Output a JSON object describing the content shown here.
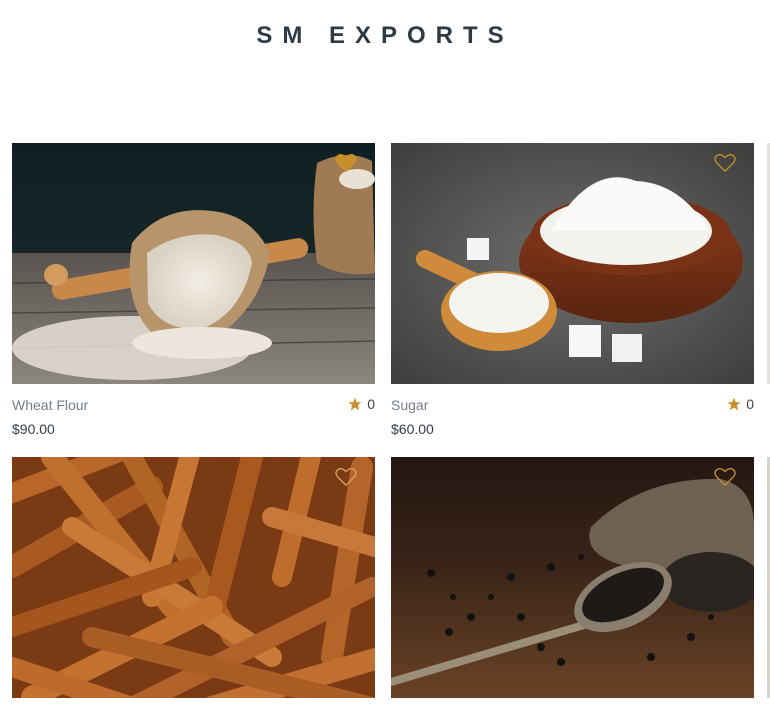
{
  "brand": {
    "title": "SM EXPORTS"
  },
  "colors": {
    "accent": "#c8902a",
    "text": "#333d46",
    "muted": "#757f88"
  },
  "products": [
    {
      "name": "Wheat Flour",
      "price": "$90.00",
      "rating": "0",
      "favorited": true,
      "image": "wheat-flour-sack-photo"
    },
    {
      "name": "Sugar",
      "price": "$60.00",
      "rating": "0",
      "favorited": false,
      "image": "sugar-bowl-photo"
    },
    {
      "name": "",
      "price": "",
      "rating": "",
      "favorited": false,
      "image": "cinnamon-sticks-photo"
    },
    {
      "name": "",
      "price": "",
      "rating": "",
      "favorited": false,
      "image": "black-pepper-spoon-photo"
    }
  ]
}
